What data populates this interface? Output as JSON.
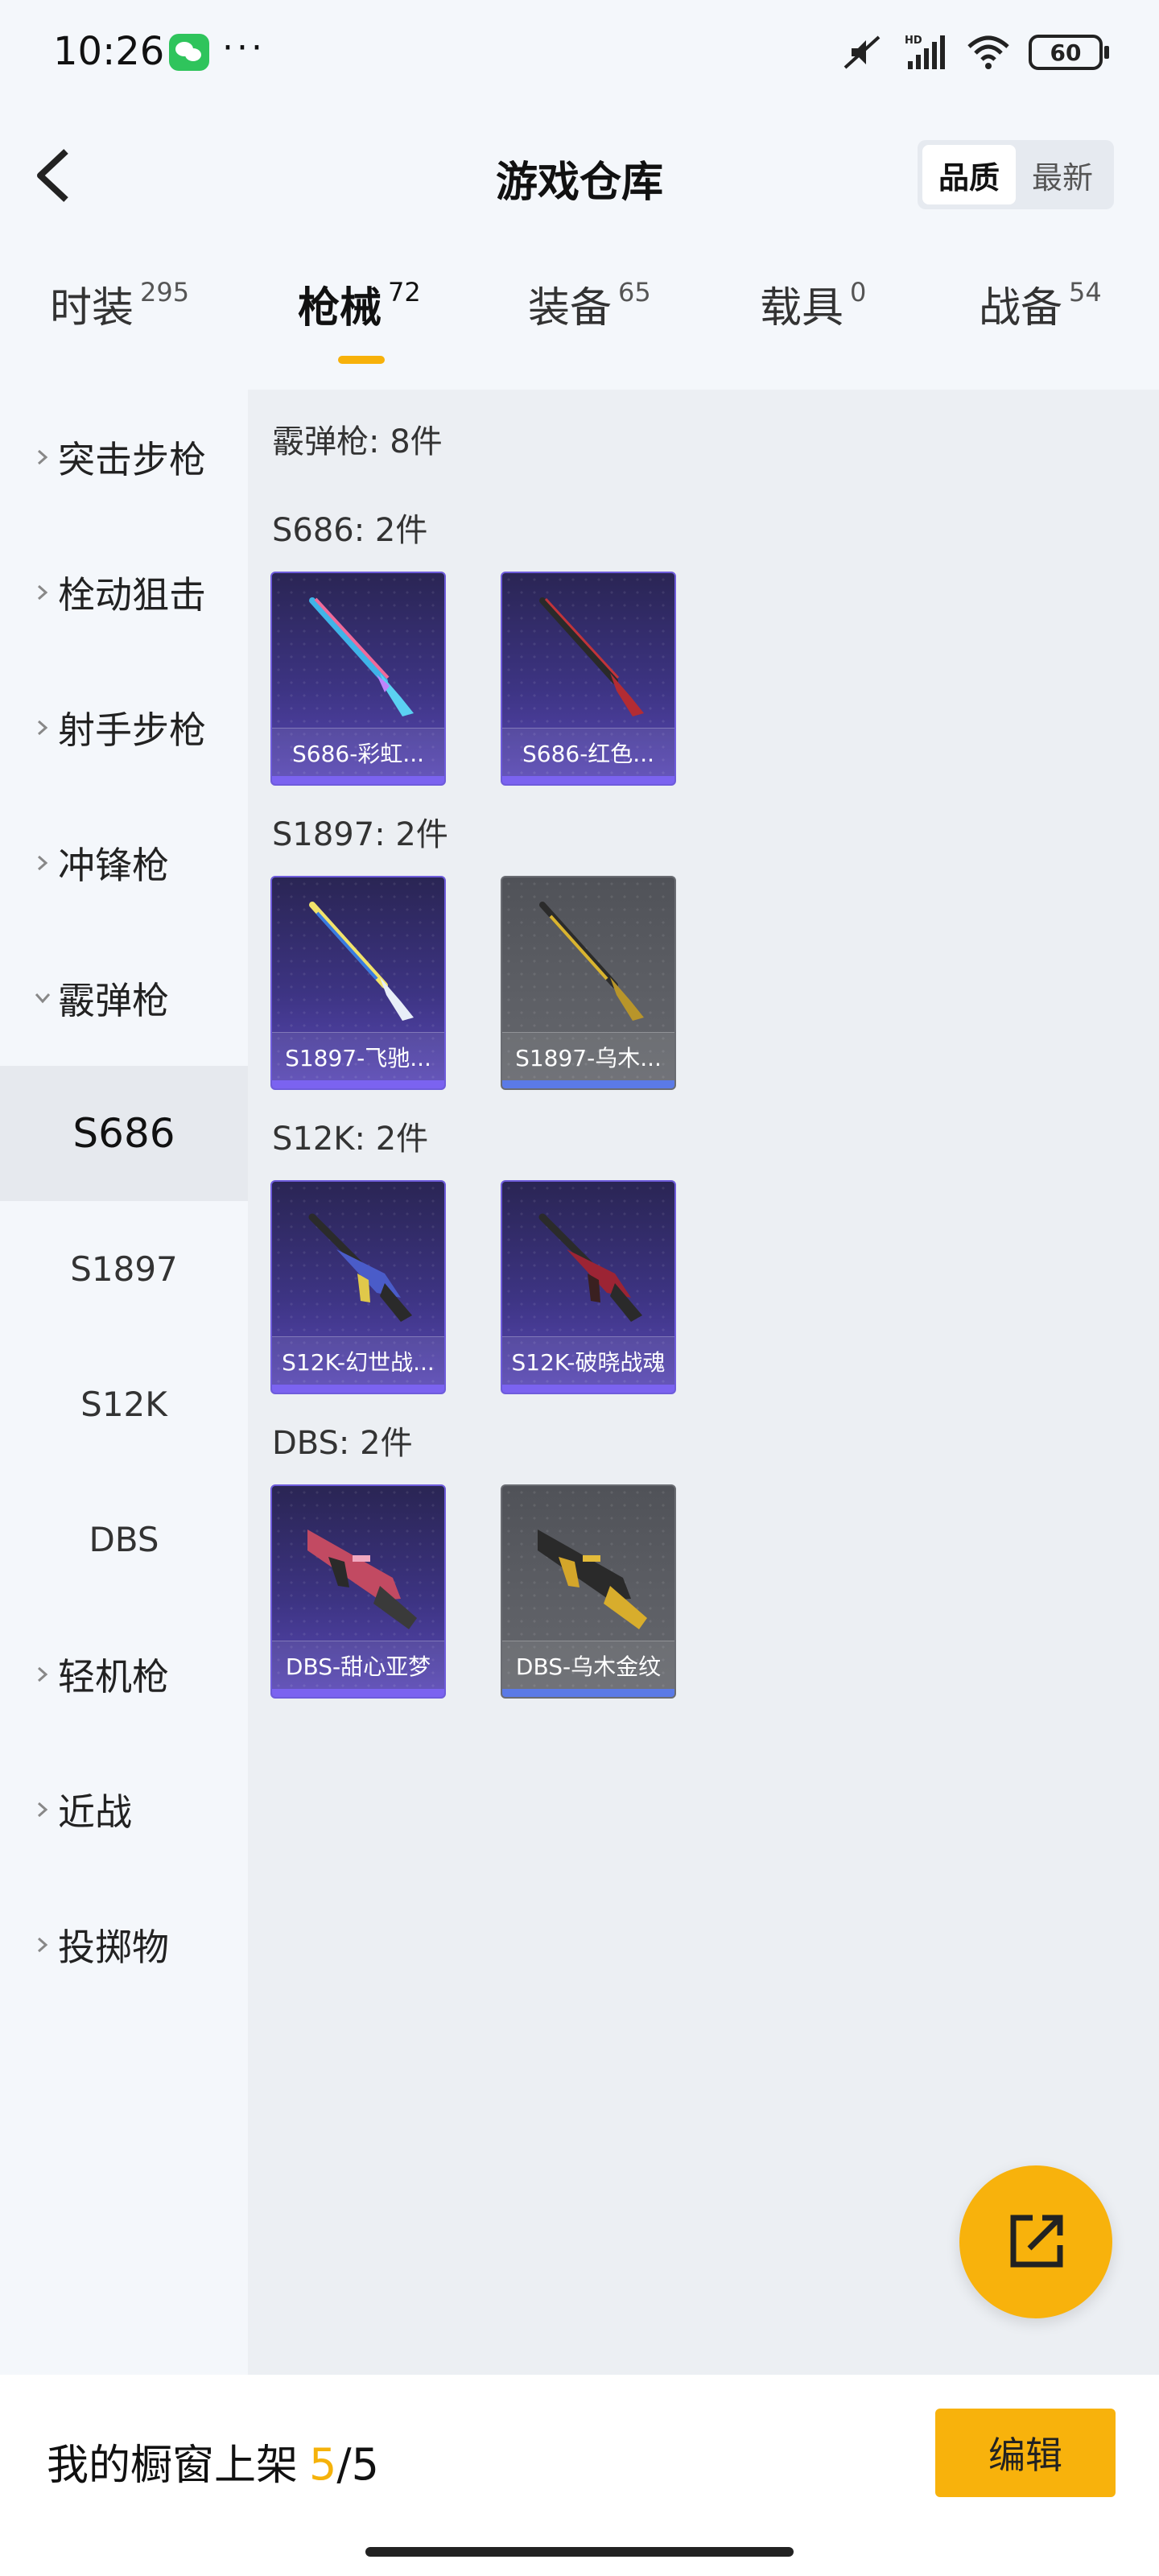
{
  "status_bar": {
    "time": "10:26",
    "more": "···",
    "battery": "60",
    "icons": [
      "wechat-icon",
      "mute-icon",
      "signal-icon",
      "wifi-icon",
      "battery-icon"
    ]
  },
  "header": {
    "title": "游戏仓库",
    "sort_options": [
      {
        "label": "品质",
        "active": true
      },
      {
        "label": "最新",
        "active": false
      }
    ]
  },
  "category_tabs": [
    {
      "name": "时装",
      "count": "295"
    },
    {
      "name": "枪械",
      "count": "72",
      "active": true
    },
    {
      "name": "装备",
      "count": "65"
    },
    {
      "name": "载具",
      "count": "0"
    },
    {
      "name": "战备",
      "count": "54"
    }
  ],
  "sidebar": {
    "items": [
      {
        "label": "突击步枪"
      },
      {
        "label": "栓动狙击"
      },
      {
        "label": "射手步枪"
      },
      {
        "label": "冲锋枪"
      },
      {
        "label": "霰弹枪",
        "expanded": true
      },
      {
        "label": "轻机枪"
      },
      {
        "label": "近战"
      },
      {
        "label": "投掷物"
      }
    ],
    "sub_items": [
      {
        "label": "S686",
        "active": true
      },
      {
        "label": "S1897"
      },
      {
        "label": "S12K"
      },
      {
        "label": "DBS"
      }
    ]
  },
  "content": {
    "heading": "霰弹枪: 8件",
    "sections": [
      {
        "title": "S686: 2件",
        "items": [
          {
            "name": "S686-彩虹...",
            "quality": "purple"
          },
          {
            "name": "S686-红色...",
            "quality": "purple"
          }
        ]
      },
      {
        "title": "S1897: 2件",
        "items": [
          {
            "name": "S1897-飞驰...",
            "quality": "purple"
          },
          {
            "name": "S1897-乌木...",
            "quality": "grey"
          }
        ]
      },
      {
        "title": "S12K: 2件",
        "items": [
          {
            "name": "S12K-幻世战...",
            "quality": "purple"
          },
          {
            "name": "S12K-破晓战魂",
            "quality": "purple"
          }
        ]
      },
      {
        "title": "DBS: 2件",
        "items": [
          {
            "name": "DBS-甜心亚梦",
            "quality": "purple"
          },
          {
            "name": "DBS-乌木金纹",
            "quality": "grey"
          }
        ]
      }
    ]
  },
  "fab": {
    "icon": "share-icon"
  },
  "bottom_bar": {
    "label": "我的橱窗上架",
    "current": "5",
    "separator": "/",
    "total": "5",
    "edit_label": "编辑"
  },
  "colors": {
    "accent": "#f8b20c",
    "purple_quality": "#7b63f0",
    "grey_quality": "#5b7ae6"
  }
}
